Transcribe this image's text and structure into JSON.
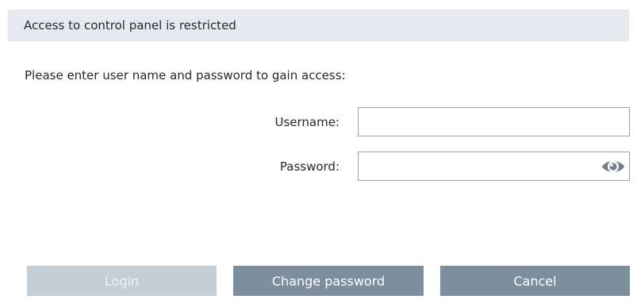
{
  "dialog": {
    "title": "Access to control panel is restricted",
    "prompt": "Please enter user name and password to gain access:"
  },
  "form": {
    "username_label": "Username:",
    "username_value": "",
    "password_label": "Password:",
    "password_value": "",
    "reveal_icon": "eye-icon"
  },
  "buttons": {
    "login": "Login",
    "change_password": "Change password",
    "cancel": "Cancel"
  },
  "colors": {
    "title_bar": "#e6eaf0",
    "button_active": "#7d8f9f",
    "button_disabled": "#c4ced7",
    "eye_icon": "#6f7f8e"
  }
}
